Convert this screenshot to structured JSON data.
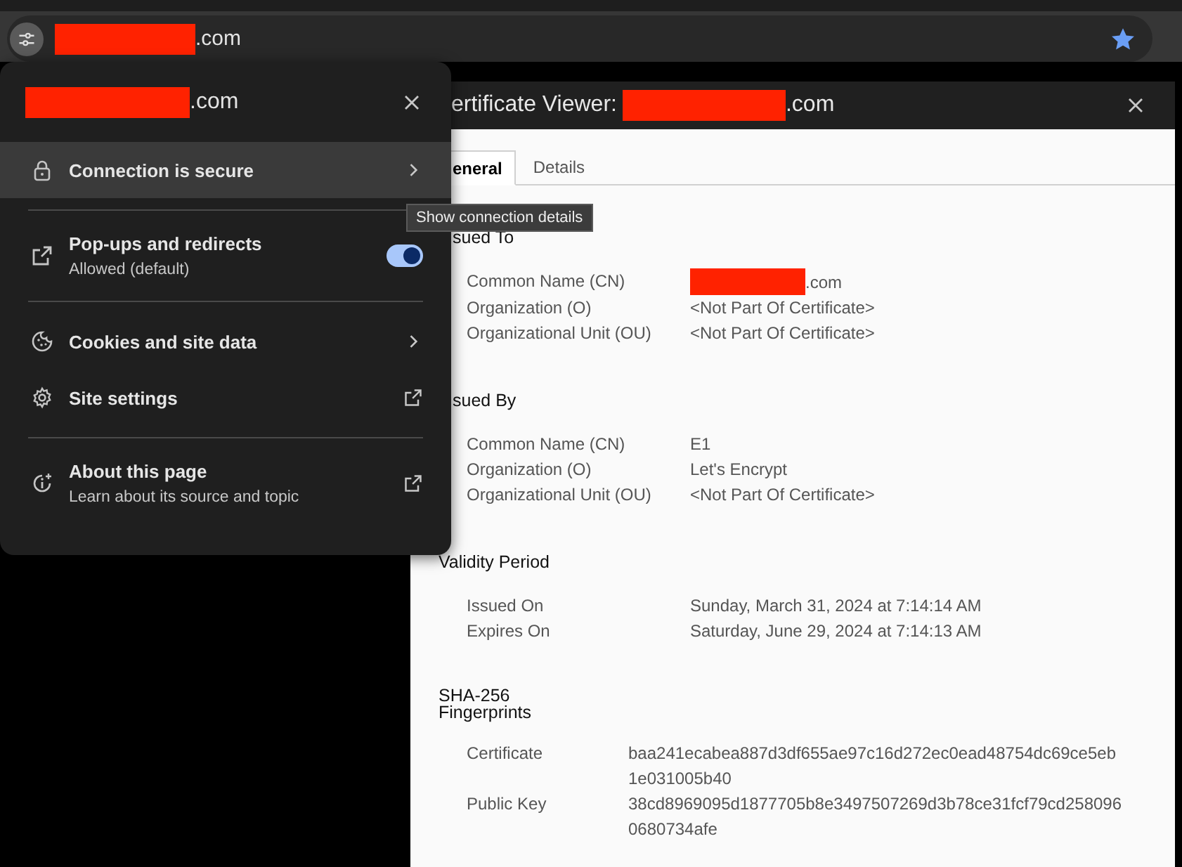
{
  "browser": {
    "address_bar": {
      "url": {
        "redacted": true,
        "visible_text": ".com"
      },
      "bookmarked": true
    }
  },
  "site_popup": {
    "domain": {
      "redacted": true,
      "visible_text": ".com"
    },
    "groups": [
      [
        {
          "kind": "nav",
          "label": "Connection is secure",
          "highlighted": true
        }
      ],
      [
        {
          "kind": "toggle",
          "label": "Pop-ups and redirects",
          "sublabel": "Allowed (default)",
          "on": true,
          "highlighted": false
        }
      ],
      [
        {
          "kind": "nav",
          "label": "Cookies and site data",
          "highlighted": false
        },
        {
          "kind": "external",
          "label": "Site settings",
          "highlighted": false
        }
      ],
      [
        {
          "kind": "external",
          "label": "About this page",
          "sublabel": "Learn about its source and topic",
          "highlighted": false
        }
      ]
    ]
  },
  "tooltip": {
    "text": "Show connection details"
  },
  "certificate_viewer": {
    "title": {
      "text": "ertificate Viewer:",
      "domain": {
        "redacted": true,
        "visible_text": ".com"
      }
    },
    "tabs": [
      {
        "label": "eneral",
        "selected": true
      },
      {
        "label": "Details",
        "selected": false
      }
    ],
    "sections": [
      {
        "kind": "fields",
        "heading": "sued To",
        "rows": [
          {
            "label": "Common Name (CN)",
            "value": ".com",
            "redacted": true
          },
          {
            "label": "Organization (O)",
            "value": "<Not Part Of Certificate>",
            "redacted": false
          },
          {
            "label": "Organizational Unit (OU)",
            "value": "<Not Part Of Certificate>",
            "redacted": false
          }
        ]
      },
      {
        "kind": "fields",
        "heading": "sued By",
        "rows": [
          {
            "label": "Common Name (CN)",
            "value": "E1",
            "redacted": false
          },
          {
            "label": "Organization (O)",
            "value": "Let's Encrypt",
            "redacted": false
          },
          {
            "label": "Organizational Unit (OU)",
            "value": "<Not Part Of Certificate>",
            "redacted": false
          }
        ]
      },
      {
        "kind": "fields",
        "heading": "Validity Period",
        "rows": [
          {
            "label": "Issued On",
            "value": "Sunday, March 31, 2024 at 7:14:14 AM",
            "redacted": false
          },
          {
            "label": "Expires On",
            "value": "Saturday, June 29, 2024 at 7:14:13 AM",
            "redacted": false
          }
        ]
      },
      {
        "kind": "fingerprints",
        "heading": "SHA-256 Fingerprints",
        "rows": [
          {
            "label": "Certificate",
            "value": "baa241ecabea887d3df655ae97c16d272ec0ead48754dc69ce5eb1e031005b40",
            "redacted": false
          },
          {
            "label": "Public Key",
            "value": "38cd8969095d1877705b8e3497507269d3b78ce31fcf79cd2580960680734afe",
            "redacted": false
          }
        ]
      }
    ]
  }
}
